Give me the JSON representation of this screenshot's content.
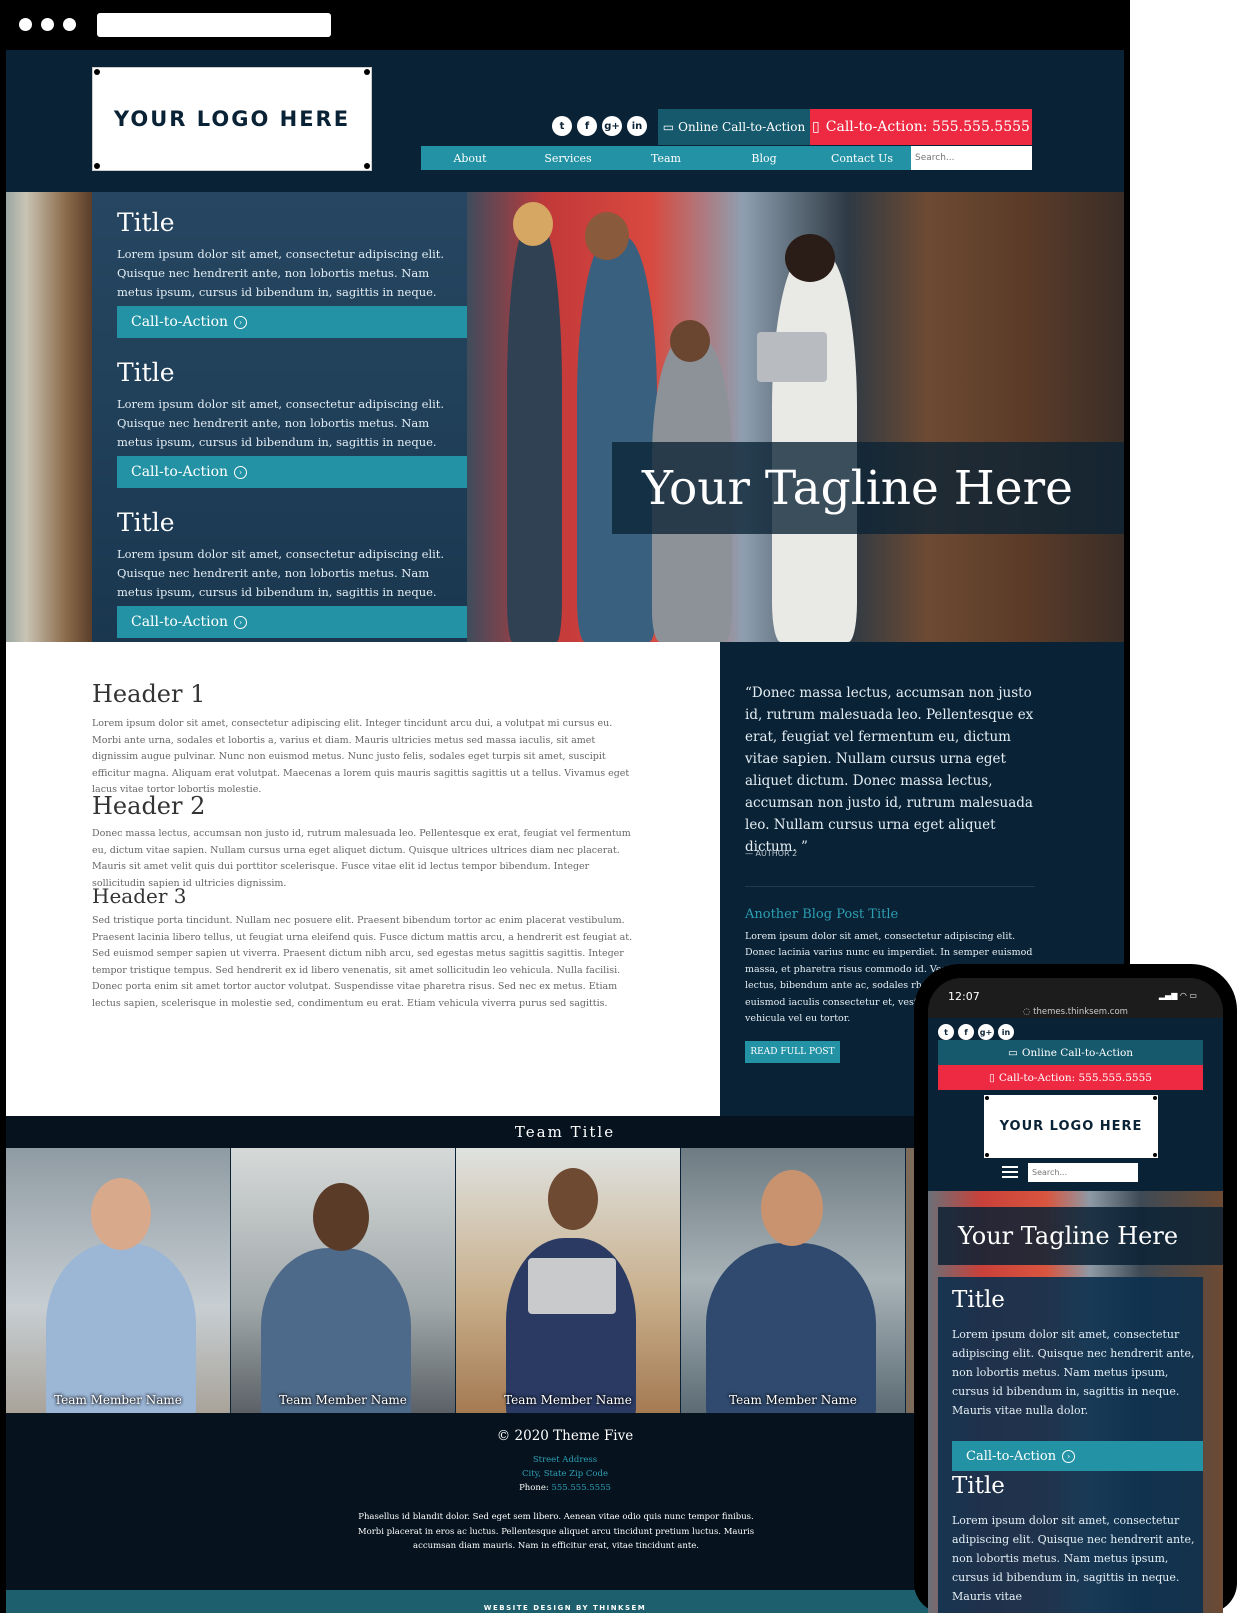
{
  "site": {
    "logo": "YOUR LOGO HERE",
    "socials": [
      "twitter",
      "facebook",
      "google-plus",
      "linkedin"
    ],
    "cta_online": "Online Call-to-Action",
    "cta_phone": "Call-to-Action: 555.555.5555",
    "nav": [
      "About",
      "Services",
      "Team",
      "Blog",
      "Contact Us"
    ],
    "search_placeholder": "Search..."
  },
  "hero": {
    "blocks": [
      {
        "title": "Title",
        "text": "Lorem ipsum dolor sit amet, consectetur adipiscing elit. Quisque nec hendrerit ante, non lobortis metus. Nam metus ipsum, cursus id bibendum in, sagittis in neque. Mauris vitae nulla dolor.",
        "cta": "Call-to-Action"
      },
      {
        "title": "Title",
        "text": "Lorem ipsum dolor sit amet, consectetur adipiscing elit. Quisque nec hendrerit ante, non lobortis metus. Nam metus ipsum, cursus id bibendum in, sagittis in neque. Mauris vitae nulla dolor.",
        "cta": "Call-to-Action"
      },
      {
        "title": "Title",
        "text": "Lorem ipsum dolor sit amet, consectetur adipiscing elit. Quisque nec hendrerit ante, non lobortis metus. Nam metus ipsum, cursus id bibendum in, sagittis in neque. Mauris vitae nulla dolor.",
        "cta": "Call-to-Action"
      }
    ],
    "tagline": "Your Tagline Here"
  },
  "content": {
    "sections": [
      {
        "header": "Header 1",
        "text": "Lorem ipsum dolor sit amet, consectetur adipiscing elit. Integer tincidunt arcu dui, a volutpat mi cursus eu. Morbi ante urna, sodales et lobortis a, varius et diam. Mauris ultricies metus sed massa iaculis, sit amet dignissim augue pulvinar. Nunc non euismod metus. Nunc justo felis, sodales eget turpis sit amet, suscipit efficitur magna. Aliquam erat volutpat. Maecenas a lorem quis mauris sagittis sagittis ut a tellus. Vivamus eget lacus vitae tortor lobortis molestie."
      },
      {
        "header": "Header 2",
        "text": "Donec massa lectus, accumsan non justo id, rutrum malesuada leo. Pellentesque ex erat, feugiat vel fermentum eu, dictum vitae sapien. Nullam cursus urna eget aliquet dictum. Quisque ultrices ultrices diam nec placerat. Mauris sit amet velit quis dui porttitor scelerisque. Fusce vitae elit id lectus tempor bibendum. Integer sollicitudin sapien id ultricies dignissim."
      },
      {
        "header": "Header 3",
        "text": "Sed tristique porta tincidunt. Nullam nec posuere elit. Praesent bibendum tortor ac enim placerat vestibulum. Praesent lacinia libero tellus, ut feugiat urna eleifend quis. Fusce dictum mattis arcu, a hendrerit est feugiat at. Sed euismod semper sapien ut viverra. Praesent dictum nibh arcu, sed egestas metus sagittis sagittis. Integer tempor tristique tempus. Sed hendrerit ex id libero venenatis, sit amet sollicitudin leo vehicula. Nulla facilisi. Donec porta enim sit amet tortor auctor volutpat. Suspendisse vitae pharetra risus. Sed nec ex metus. Etiam lectus sapien, scelerisque in molestie sed, condimentum eu erat. Etiam vehicula viverra purus sed sagittis."
      }
    ]
  },
  "sidebar": {
    "quote": "“Donec massa lectus, accumsan non justo id, rutrum malesuada leo. Pellentesque ex erat, feugiat vel fermentum eu, dictum vitae sapien. Nullam cursus urna eget aliquet dictum. Donec massa lectus, accumsan non justo id, rutrum malesuada leo. Nullam cursus urna eget aliquet dictum. ”",
    "author": "— AUTHOR 2",
    "blog_title": "Another Blog Post Title",
    "blog_text": "Lorem ipsum dolor sit amet, consectetur adipiscing elit. Donec lacinia varius nunc eu imperdiet. In semper euismod massa, et pharetra risus commodo id. Vestibulum tortor lectus, bibendum ante ac, sodales rhoncus ex. Vivamus euismod iaculis consectetur et, vestibulum id dui imperdiet vehicula vel eu tortor.",
    "read_more": "READ FULL POST"
  },
  "team": {
    "title": "Team Title",
    "members": [
      "Team Member Name",
      "Team Member Name",
      "Team Member Name",
      "Team Member Name"
    ]
  },
  "footer": {
    "copyright": "© 2020 Theme Five",
    "street": "Street Address",
    "city": "City, State Zip Code",
    "phone_label": "Phone: ",
    "phone": "555.555.5555",
    "description": "Phasellus id blandit dolor. Sed eget sem libero. Aenean vitae odio quis nunc tempor finibus. Morbi placerat in eros ac luctus. Pellentesque aliquet arcu tincidunt pretium luctus. Mauris accumsan diam mauris. Nam in efficitur erat, vitae tincidunt ante.",
    "credit": "WEBSITE DESIGN BY THINKSEM"
  },
  "phone": {
    "time": "12:07",
    "indicators": "▂▄▆ ◠ ▭",
    "url": "◌ themes.thinksem.com",
    "cta_online": "Online Call-to-Action",
    "cta_phone": "Call-to-Action: 555.555.5555",
    "logo": "YOUR LOGO HERE",
    "search_placeholder": "Search...",
    "tagline": "Your Tagline Here",
    "block1_title": "Title",
    "block1_text": "Lorem ipsum dolor sit amet, consectetur adipiscing elit. Quisque nec hendrerit ante, non lobortis metus. Nam metus ipsum, cursus id bibendum in, sagittis in neque. Mauris vitae nulla dolor.",
    "block1_cta": "Call-to-Action",
    "block2_title": "Title",
    "block2_text": "Lorem ipsum dolor sit amet, consectetur adipiscing elit. Quisque nec hendrerit ante, non lobortis metus. Nam metus ipsum, cursus id bibendum in, sagittis in neque. Mauris vitae"
  },
  "colors": {
    "navy": "#0a2235",
    "teal": "#2392a4",
    "dark_teal": "#16596d",
    "red": "#ee2a43",
    "footer": "#06131e"
  }
}
